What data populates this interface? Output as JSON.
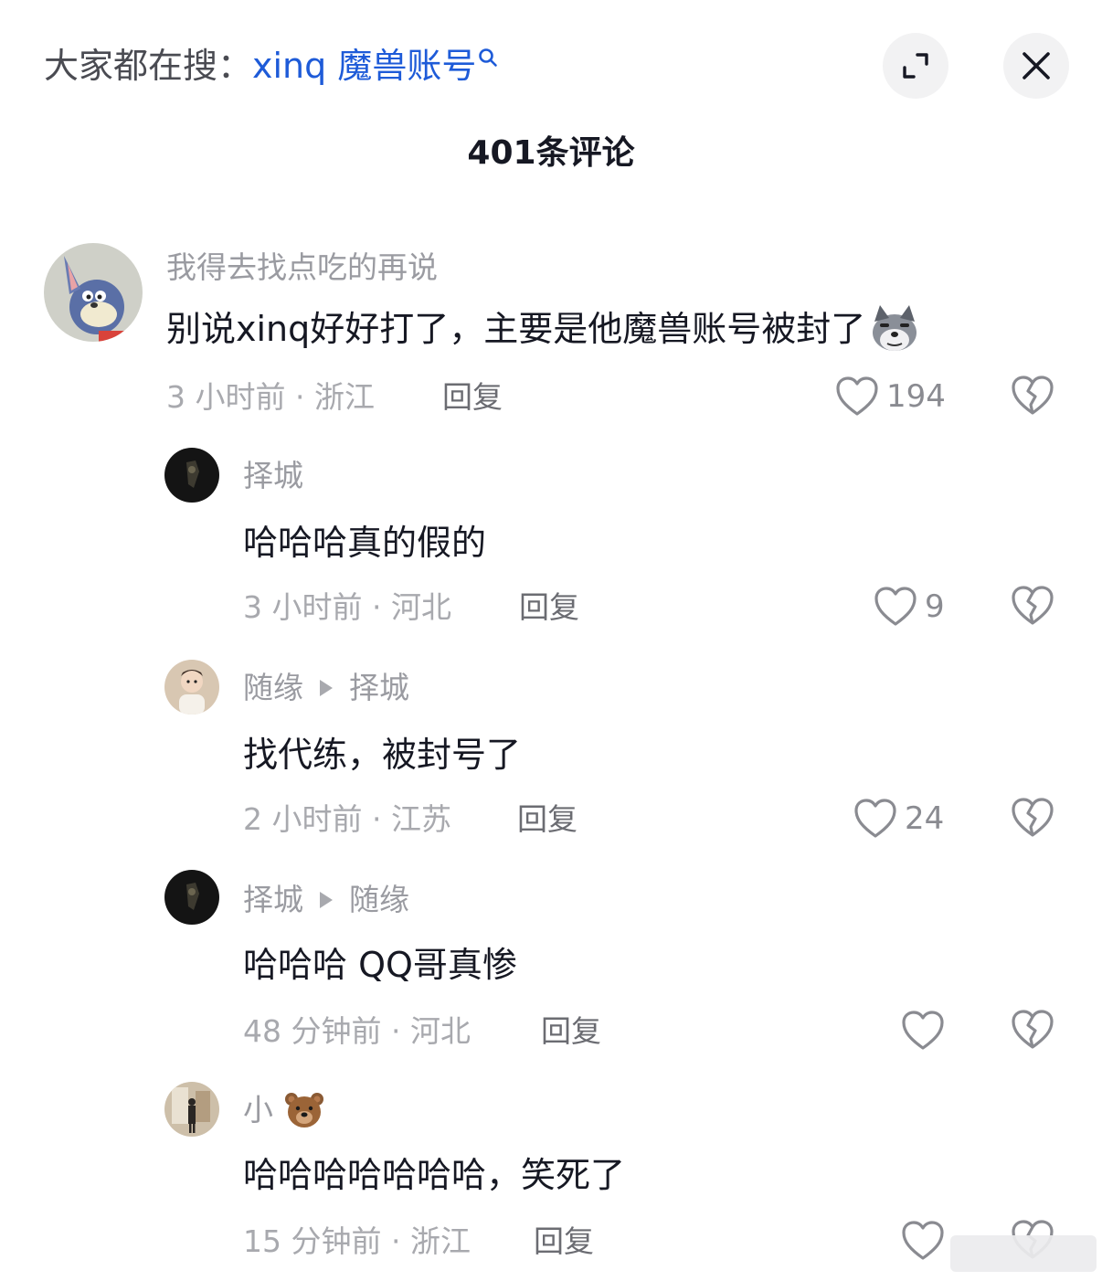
{
  "header": {
    "search_prefix": "大家都在搜：",
    "search_term": "xinq 魔兽账号",
    "expand_icon": "expand-icon",
    "close_icon": "close-icon"
  },
  "comment_count_title": "401条评论",
  "comments": [
    {
      "username": "我得去找点吃的再说",
      "text": "别说xinq好好打了，主要是他魔兽账号被封了",
      "emoji": "doge-wolf-emoji",
      "meta": "3 小时前 · 浙江",
      "reply_label": "回复",
      "likes": "194"
    },
    {
      "username": "择城",
      "text": "哈哈哈真的假的",
      "meta": "3 小时前 · 河北",
      "reply_label": "回复",
      "likes": "9"
    },
    {
      "username": "随缘",
      "reply_to": "择城",
      "text": "找代练，被封号了",
      "meta": "2 小时前 · 江苏",
      "reply_label": "回复",
      "likes": "24"
    },
    {
      "username": "择城",
      "reply_to": "随缘",
      "text": "哈哈哈 QQ哥真惨",
      "meta": "48 分钟前 · 河北",
      "reply_label": "回复",
      "likes": ""
    },
    {
      "username": "小",
      "username_emoji": "bear-face-emoji",
      "text": "哈哈哈哈哈哈哈，笑死了",
      "meta": "15 分钟前 · 浙江",
      "reply_label": "回复",
      "likes": ""
    }
  ],
  "colors": {
    "search_term": "#1e5bd8",
    "text_primary": "#161823",
    "text_secondary": "#a8a9ae"
  }
}
